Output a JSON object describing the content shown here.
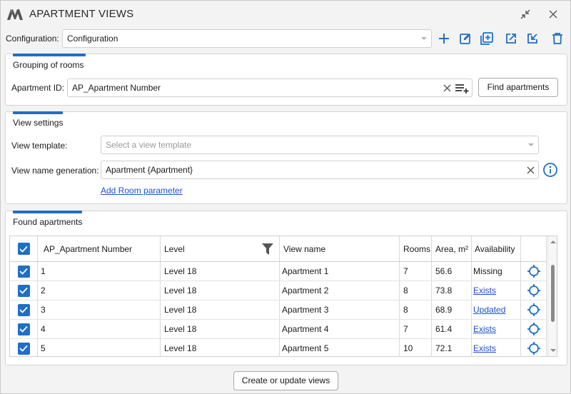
{
  "window": {
    "title": "APARTMENT VIEWS"
  },
  "titlebar": {
    "collapse_icon": "collapse-arrows-icon",
    "close_icon": "close-icon"
  },
  "configuration": {
    "label": "Configuration:",
    "value": "Configuration",
    "actions": [
      "add-icon",
      "edit-icon",
      "duplicate-icon",
      "export-icon",
      "import-icon",
      "delete-icon"
    ]
  },
  "grouping": {
    "title": "Grouping of rooms",
    "apartment_id_label": "Apartment ID:",
    "apartment_id_value": "AP_Apartment Number",
    "find_button": "Find apartments"
  },
  "view_settings": {
    "title": "View settings",
    "template_label": "View template:",
    "template_placeholder": "Select a view template",
    "name_gen_label": "View name generation:",
    "name_gen_value": "Apartment {Apartment}",
    "add_param_link": "Add Room parameter"
  },
  "found": {
    "title": "Found apartments",
    "columns": [
      "AP_Apartment Number",
      "Level",
      "View name",
      "Rooms",
      "Area, m²",
      "Availability"
    ],
    "rows": [
      {
        "number": "1",
        "level": "Level 18",
        "view_name": "Apartment 1",
        "rooms": "7",
        "area": "56.6",
        "availability": "Missing",
        "link": false
      },
      {
        "number": "2",
        "level": "Level 18",
        "view_name": "Apartment 2",
        "rooms": "8",
        "area": "73.8",
        "availability": "Exists",
        "link": true
      },
      {
        "number": "3",
        "level": "Level 18",
        "view_name": "Apartment 3",
        "rooms": "8",
        "area": "68.9",
        "availability": "Updated",
        "link": true
      },
      {
        "number": "4",
        "level": "Level 18",
        "view_name": "Apartment 4",
        "rooms": "7",
        "area": "61.4",
        "availability": "Exists",
        "link": true
      },
      {
        "number": "5",
        "level": "Level 18",
        "view_name": "Apartment 5",
        "rooms": "10",
        "area": "72.1",
        "availability": "Exists",
        "link": true
      }
    ]
  },
  "footer": {
    "create_button": "Create or update views"
  },
  "colors": {
    "accent": "#1f6fc5",
    "link": "#1f4fd1"
  }
}
